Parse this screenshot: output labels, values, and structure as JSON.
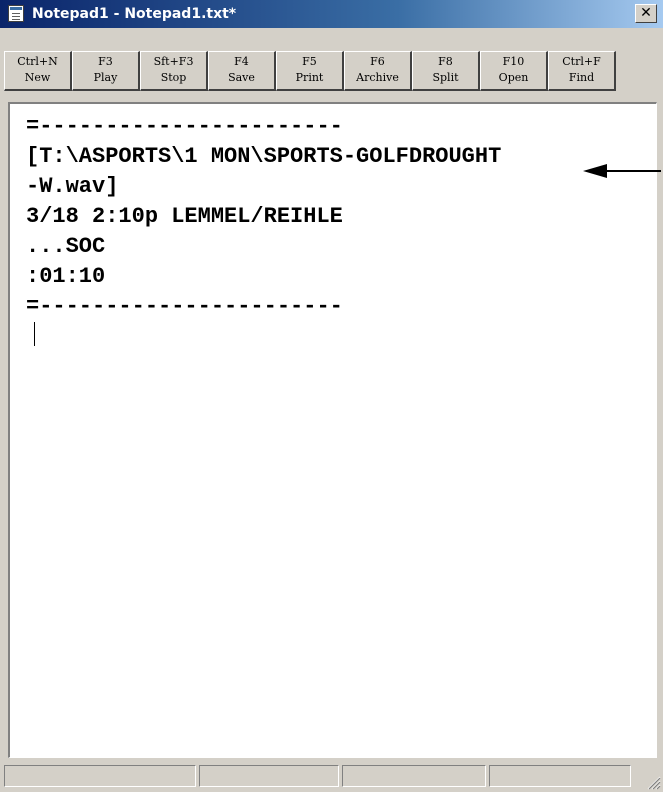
{
  "window": {
    "title": "Notepad1 - Notepad1.txt*",
    "close_label": "✕"
  },
  "toolbar": {
    "buttons": [
      {
        "key": "Ctrl+N",
        "label": "New"
      },
      {
        "key": "F3",
        "label": "Play"
      },
      {
        "key": "Sft+F3",
        "label": "Stop"
      },
      {
        "key": "F4",
        "label": "Save"
      },
      {
        "key": "F5",
        "label": "Print"
      },
      {
        "key": "F6",
        "label": "Archive"
      },
      {
        "key": "F8",
        "label": "Split"
      },
      {
        "key": "F10",
        "label": "Open"
      },
      {
        "key": "Ctrl+F",
        "label": "Find"
      }
    ]
  },
  "editor": {
    "lines": [
      "=-----------------------",
      "[T:\\ASPORTS\\1 MON\\SPORTS-GOLFDROUGHT",
      "-W.wav]",
      "3/18 2:10p LEMMEL/REIHLE",
      "...SOC",
      ":01:10",
      "=-----------------------"
    ]
  },
  "statusbar": {
    "panels": [
      "",
      "",
      "",
      ""
    ]
  }
}
